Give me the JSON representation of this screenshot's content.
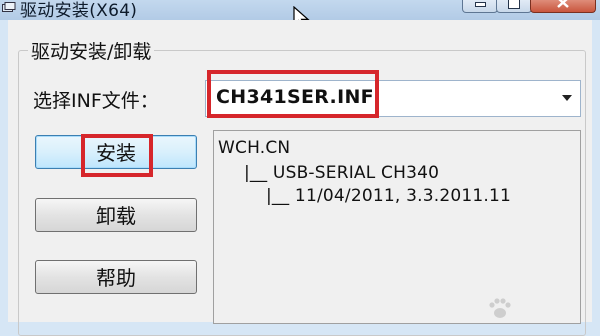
{
  "window": {
    "title": "驱动安装(X64)",
    "icon": "app-icon",
    "controls": [
      "minimize-button",
      "maximize-button",
      "close-button"
    ]
  },
  "group": {
    "caption": "驱动安装/卸载"
  },
  "inf": {
    "label": "选择INF文件：",
    "selected": "CH341SER.INF"
  },
  "buttons": {
    "install": "安装",
    "uninstall": "卸载",
    "help": "帮助"
  },
  "info": {
    "lines": [
      "WCH.CN",
      "|__ USB-SERIAL CH340",
      "|__ 11/04/2011, 3.3.2011.11"
    ]
  },
  "colors": {
    "highlight": "#d6262b",
    "focus_border": "#3c7fb1"
  }
}
